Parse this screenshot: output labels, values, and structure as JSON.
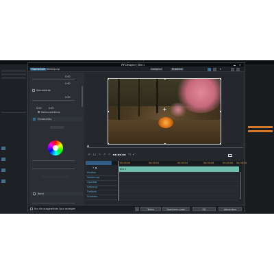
{
  "dialog": {
    "title": "PiP-Designer | Bild 1",
    "tabs": [
      {
        "label": "Eigenschaft",
        "active": true
      },
      {
        "label": "Bewegung",
        "active": false
      }
    ],
    "view_tabs": [
      {
        "label": "Designer",
        "active": false
      },
      {
        "label": "Erweitert",
        "active": true
      }
    ]
  },
  "properties": {
    "values": [
      "0.00",
      "0.00",
      "0.00",
      "0.00",
      "0.00"
    ],
    "sections": [
      {
        "label": "Kantenfarbe",
        "checked": true
      },
      {
        "label": "Chroma Key",
        "checked": true
      },
      {
        "label": "Rand",
        "checked": false
      }
    ],
    "ratio_label": "Seitenverhältnis",
    "color_wheel": {
      "colors": [
        "#ff0000",
        "#ffff00",
        "#00ff00",
        "#00ffff",
        "#0000ff",
        "#ff00ff"
      ]
    }
  },
  "timeline": {
    "time_markers": [
      "00:00:00",
      "00:00:02",
      "00:00:04",
      "00:00:06",
      "00:00:08",
      "00:00:10"
    ],
    "tracks": [
      "Position",
      "Skalierung",
      "Opazität",
      "Drehung",
      "Freiform",
      "Schatten"
    ],
    "clip_label": "Bild 1",
    "accent": "#6fbfaf"
  },
  "footer": {
    "checkbox_label": "Nur die ausgewählte Spur anzeigen",
    "buttons": [
      "Teilen",
      "Speichern unter",
      "OK",
      "Abbrechen"
    ]
  }
}
